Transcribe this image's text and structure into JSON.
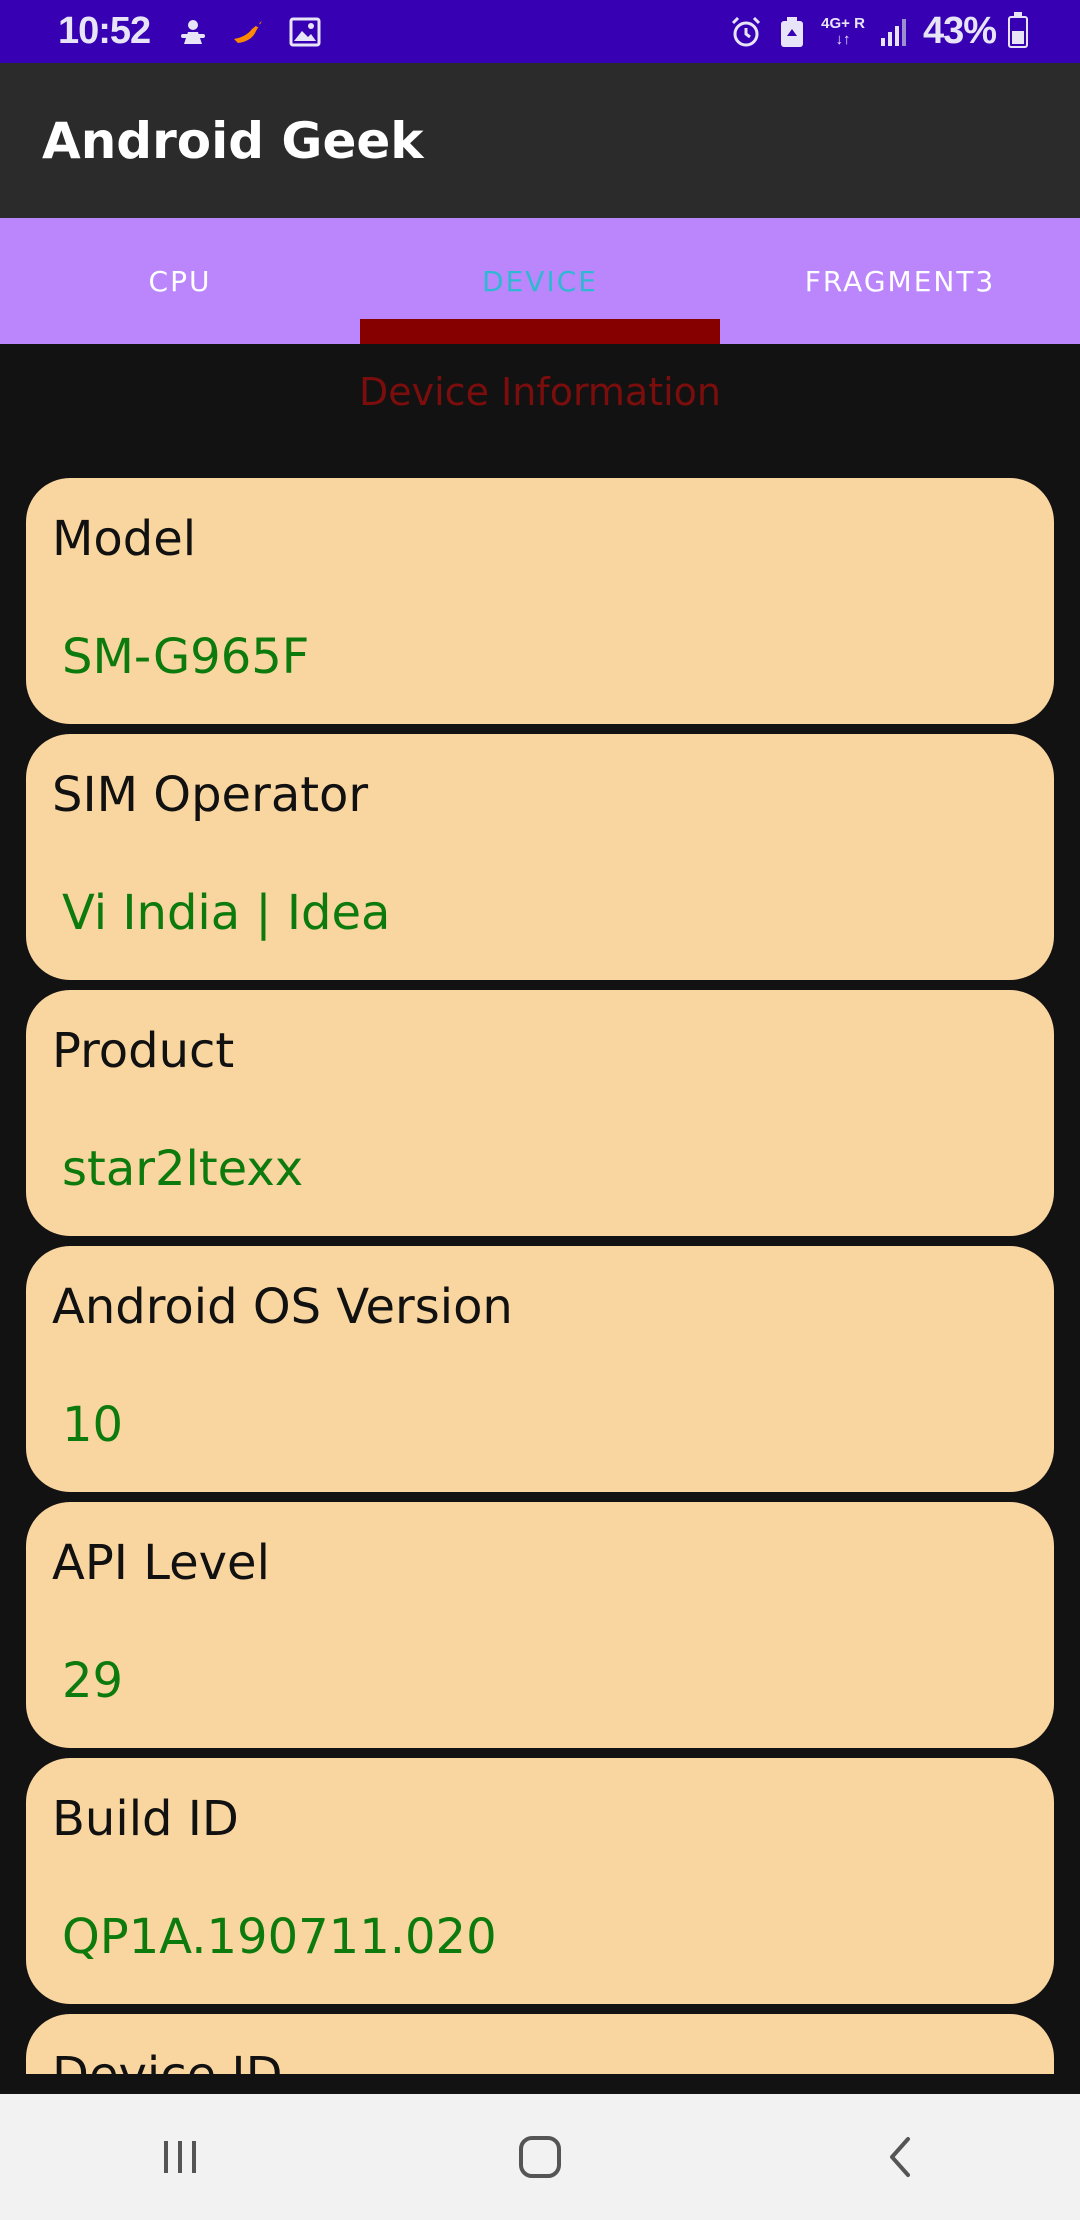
{
  "status_bar": {
    "time": "10:52",
    "network": "4G+",
    "roaming": "R",
    "battery": "43%",
    "battery_level": 0.43,
    "icons": [
      "pilot-icon",
      "bird-icon",
      "gallery-icon",
      "alarm-icon",
      "recycle-icon",
      "signal-icon",
      "battery-icon"
    ]
  },
  "app": {
    "title": "Android Geek"
  },
  "tabs": [
    {
      "label": "CPU",
      "selected": false
    },
    {
      "label": "DEVICE",
      "selected": true
    },
    {
      "label": "FRAGMENT3",
      "selected": false
    }
  ],
  "section_title": "Device Information",
  "cards": [
    {
      "label": "Model",
      "value": "SM-G965F"
    },
    {
      "label": "SIM Operator",
      "value": "Vi India | Idea"
    },
    {
      "label": "Product",
      "value": "star2ltexx"
    },
    {
      "label": "Android OS Version",
      "value": "10"
    },
    {
      "label": "API Level",
      "value": "29"
    },
    {
      "label": "Build ID",
      "value": "QP1A.190711.020"
    },
    {
      "label": "Device ID",
      "value": ""
    }
  ],
  "nav_bar": {
    "buttons": [
      "recent-apps-icon",
      "home-icon",
      "back-icon"
    ]
  },
  "colors": {
    "status_bar": "#3700b3",
    "app_bar": "#2b2b2b",
    "tab_bar": "#bb86fc",
    "tab_indicator": "#860000",
    "tab_selected_text": "#2fb8d2",
    "section_title": "#7c0d0d",
    "card_bg": "#f9d6a0",
    "card_value": "#0d7a0d",
    "background": "#121212"
  }
}
